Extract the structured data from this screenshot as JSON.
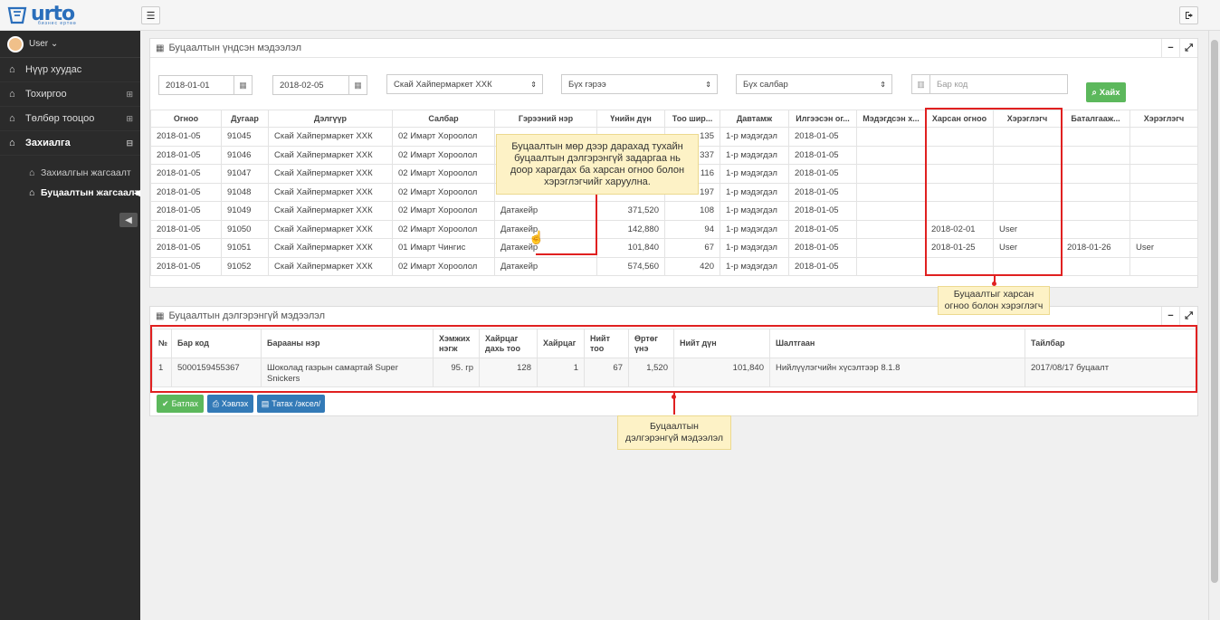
{
  "app": {
    "logo": "urto",
    "logo_sub": "бизнес ертөө"
  },
  "user": {
    "name": "User ⌄"
  },
  "sidebar": {
    "items": [
      {
        "label": "Нүүр хуудас",
        "icon": "home-icon"
      },
      {
        "label": "Тохиргоо",
        "icon": "home-icon",
        "toggle": "⊞"
      },
      {
        "label": "Төлбөр тооцоо",
        "icon": "home-icon",
        "toggle": "⊞"
      },
      {
        "label": "Захиалга",
        "icon": "home-icon",
        "toggle": "⊟"
      }
    ],
    "subitems": [
      {
        "label": "Захиалгын жагсаалт"
      },
      {
        "label": "Буцаалтын жагсаалт"
      }
    ]
  },
  "panel1": {
    "title": "Буцаалтын үндсэн мэдээлэл"
  },
  "filters": {
    "date_from": "2018-01-01",
    "date_to": "2018-02-05",
    "store": "Скай Хайпермаркет ХХК",
    "contract": "Бүх гэрээ",
    "branch": "Бүх салбар",
    "barcode_placeholder": "Бар код",
    "search_label": "Хайх"
  },
  "main_table": {
    "headers": [
      "Огноо",
      "Дугаар",
      "Дэлгүүр",
      "Салбар",
      "Гэрээний нэр",
      "Үнийн дүн",
      "Тоо шир...",
      "Давтамж",
      "Илгээсэн ог...",
      "Мэдэгдсэн х...",
      "Харсан огноо",
      "Хэрэглэгч",
      "Баталгааж...",
      "Хэрэглэгч"
    ],
    "rows": [
      [
        "2018-01-05",
        "91045",
        "Скай Хайпермаркет ХХК",
        "02 Имарт Хороолол",
        "",
        "",
        "135",
        "1-р мэдэгдэл",
        "2018-01-05",
        "",
        "",
        "",
        "",
        ""
      ],
      [
        "2018-01-05",
        "91046",
        "Скай Хайпермаркет ХХК",
        "02 Имарт Хороолол",
        "",
        "",
        "337",
        "1-р мэдэгдэл",
        "2018-01-05",
        "",
        "",
        "",
        "",
        ""
      ],
      [
        "2018-01-05",
        "91047",
        "Скай Хайпермаркет ХХК",
        "02 Имарт Хороолол",
        "",
        "",
        "116",
        "1-р мэдэгдэл",
        "2018-01-05",
        "",
        "",
        "",
        "",
        ""
      ],
      [
        "2018-01-05",
        "91048",
        "Скай Хайпермаркет ХХК",
        "02 Имарт Хороолол",
        "",
        "",
        "197",
        "1-р мэдэгдэл",
        "2018-01-05",
        "",
        "",
        "",
        "",
        ""
      ],
      [
        "2018-01-05",
        "91049",
        "Скай Хайпермаркет ХХК",
        "02 Имарт Хороолол",
        "Датакейр",
        "371,520",
        "108",
        "1-р мэдэгдэл",
        "2018-01-05",
        "",
        "",
        "",
        "",
        ""
      ],
      [
        "2018-01-05",
        "91050",
        "Скай Хайпермаркет ХХК",
        "02 Имарт Хороолол",
        "Датакейр",
        "142,880",
        "94",
        "1-р мэдэгдэл",
        "2018-01-05",
        "",
        "2018-02-01",
        "User",
        "",
        ""
      ],
      [
        "2018-01-05",
        "91051",
        "Скай Хайпермаркет ХХК",
        "01 Имарт Чингис",
        "Датакейр",
        "101,840",
        "67",
        "1-р мэдэгдэл",
        "2018-01-05",
        "",
        "2018-01-25",
        "User",
        "2018-01-26",
        "User"
      ],
      [
        "2018-01-05",
        "91052",
        "Скай Хайпермаркет ХХК",
        "02 Имарт Хороолол",
        "Датакейр",
        "574,560",
        "420",
        "1-р мэдэгдэл",
        "2018-01-05",
        "",
        "",
        "",
        "",
        ""
      ]
    ]
  },
  "notes": {
    "row_click": "Буцаалтын мөр дээр дарахад тухайн буцаалтын дэлгэрэнгүй задаргаа нь доор харагдах ба харсан огноо болон хэрэглэгчийг харуулна.",
    "seen": "Буцаалтыг харсан огноо болон хэрэглэгч",
    "detail": "Буцаалтын дэлгэрэнгүй мэдээлэл"
  },
  "panel2": {
    "title": "Буцаалтын дэлгэрэнгүй мэдээлэл"
  },
  "detail_table": {
    "headers": [
      "№",
      "Бар код",
      "Барааны нэр",
      "Хэмжих нэгж",
      "Хайрцаг дахь тоо",
      "Хайрцаг",
      "Нийт тоо",
      "Өртөг үнэ",
      "Нийт дүн",
      "Шалтгаан",
      "Тайлбар"
    ],
    "rows": [
      [
        "1",
        "5000159455367",
        "Шоколад газрын самартай Super Snickers",
        "95. гр",
        "128",
        "1",
        "67",
        "1,520",
        "101,840",
        "Нийлүүлэгчийн хүсэлтээр 8.1.8",
        "2017/08/17 буцаалт"
      ]
    ]
  },
  "actions": {
    "confirm": "Батлах",
    "print": "Хэвлэх",
    "export": "Татах /эксел/"
  },
  "colors": {
    "sidebar_bg": "#2b2b2b",
    "accent_red": "#e02020",
    "note_bg": "#fdf2c6",
    "btn_green": "#5cb85c",
    "btn_blue": "#337ab7"
  }
}
